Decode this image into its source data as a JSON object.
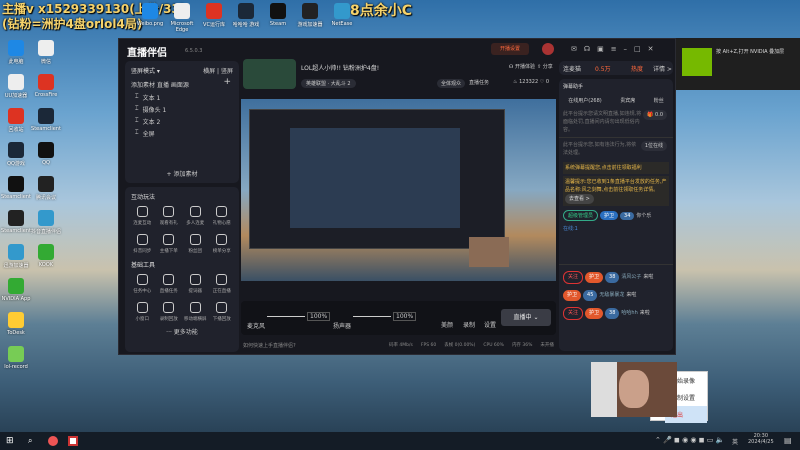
{
  "overlay": {
    "line1": "主播v x1529339130(上分/33)",
    "line2": "(钻粉=洲护4盘orlol4局)",
    "right": "8点余小C"
  },
  "desktop_top_icons": [
    "Weibo.png",
    "Microsoft Edge",
    "VC运行库",
    "哈哈哈 游戏",
    "Steam",
    "游戏加速器",
    "NetEase"
  ],
  "desktop_left_icons": [
    [
      "此电脑",
      "微信"
    ],
    [
      "UU加速器",
      "CrossFire"
    ],
    [
      "回收站",
      "Steamclient"
    ],
    [
      "QQ游戏",
      "QQ"
    ],
    [
      "Steamclient",
      "腾讯会议"
    ],
    [
      "Steamclient",
      "抖音直播伴侣"
    ],
    [
      "迅游加速器",
      "KOOK"
    ],
    [
      "NVIDIA App",
      ""
    ],
    [
      "ToDesk",
      ""
    ],
    [
      "lol-record",
      ""
    ]
  ],
  "app": {
    "name": "直播伴侣",
    "version": "6.5.0.3",
    "live_btn": "开播设置",
    "title": "LOL超人小帅!! 钻粉洲护4盘!",
    "category": "英雄联盟 · 大乱斗 2",
    "stats": {
      "feedback": "开播体验",
      "share": "分享",
      "audience": "全体观众",
      "task": "直播任务",
      "hot": "123322",
      "likes": "0"
    },
    "scene_header": "竖屏模式",
    "scene_tabs": [
      "横屏",
      "竖屏"
    ],
    "sources_label": "添加素材",
    "sources_tabs": [
      "直播",
      "画面源"
    ],
    "sources": [
      "文本 1",
      "摄像头 1",
      "文本 2",
      "全屏"
    ],
    "add_source": "添加素材",
    "interact_title": "互动玩法",
    "interact": [
      "连麦互动",
      "观看有礼",
      "多人连麦",
      "礼物心愿",
      "抖音同步",
      "主播下单",
      "粉丝团",
      "榜单分享"
    ],
    "tools_title": "基础工具",
    "tools": [
      "任务中心",
      "直播任务",
      "提词器",
      "正在直播",
      "小窗口",
      "录制回放",
      "移动端横屏",
      "下播回放"
    ],
    "more": "··· 更多功能",
    "mic_label": "麦克风",
    "mic_vol": "100%",
    "speaker_label": "扬声器",
    "speaker_vol": "100%",
    "ctrl": [
      "美颜",
      "录制",
      "设置"
    ],
    "live_button": "直播中 ⌄",
    "hint": "如何快速上手直播伴侣?",
    "status": [
      "码率 4Mb/s",
      "FPS 60",
      "丢帧 0(0.00%)",
      "CPU 60%",
      "内存 36%",
      "未开播"
    ],
    "right": {
      "tab": "连麦猫",
      "level": "0.5万",
      "hot": "热度",
      "more": "详情 >",
      "msg_title": "弹幕助手",
      "msg_tabs": [
        "在线用户(268)",
        "贵宾席",
        "粉丝"
      ],
      "sys1": "此平台提示您请文明直播,如违规,将面临处罚,直播间内请勿出现低俗内容。",
      "gift": "0.0",
      "sys2": "此平台提示您,如有违法行为,将依法处理。",
      "count": "1位在线",
      "notice1": "系统弹幕提醒您,点击前往领取福利",
      "notice2": "温馨提示:您已收到1条直播平台发放的任务,产品名称:风之剑舞,点击前往领取任务详情。",
      "notice_btn": "去查看 >",
      "tags": [
        "超级管理员",
        "护卫",
        "34",
        "你个乐"
      ],
      "online": "在线:1",
      "chats": [
        {
          "tag": "关注",
          "badge": "护卫",
          "lvl": "38",
          "user": "清风公子",
          "act": "来啦"
        },
        {
          "tag": "",
          "badge": "护卫",
          "lvl": "45",
          "user": "无敌暴暴龙",
          "act": "来啦"
        },
        {
          "tag": "关注",
          "badge": "护卫",
          "lvl": "38",
          "user": "哈哈hh",
          "act": "来啦"
        }
      ]
    }
  },
  "nvidia": {
    "text": "按 Alt+Z,打开 NVIDIA 叠加层"
  },
  "context_menu": [
    "开始录像",
    "录制设置",
    "退出"
  ],
  "taskbar": {
    "time": "20:30",
    "date": "2024/4/25",
    "lang": "英"
  },
  "colors": {
    "accent": "#ff5a36",
    "live": "#3a3c45"
  }
}
